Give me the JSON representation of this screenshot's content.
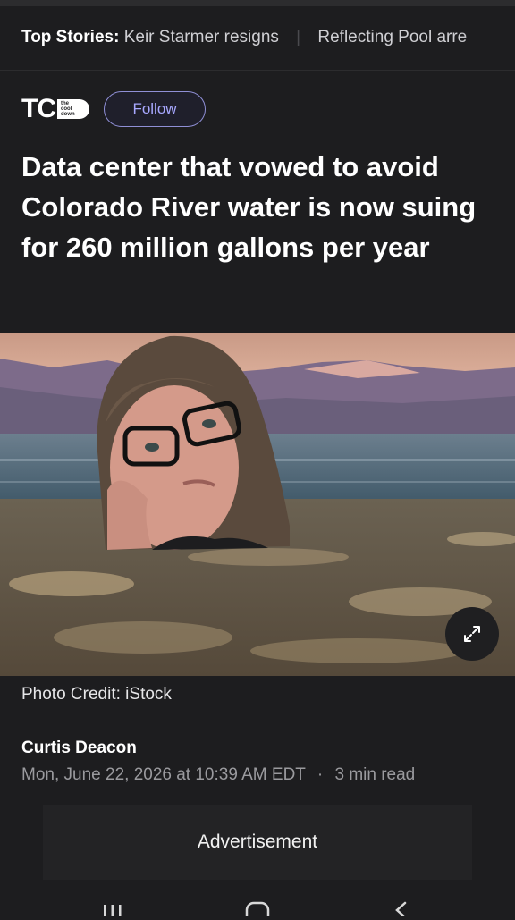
{
  "top_stories": {
    "label": "Top Stories:",
    "items": [
      "Keir Starmer resigns",
      "Reflecting Pool arre"
    ]
  },
  "publisher": {
    "logo_text": "TC",
    "logo_badge": [
      "the",
      "cool",
      "down"
    ],
    "follow_label": "Follow"
  },
  "article": {
    "headline": "Data center that vowed to avoid Colorado River water is now suing for 260 million gallons per year",
    "photo_credit": "Photo Credit: iStock",
    "author": "Curtis Deacon",
    "date": "Mon, June 22, 2026 at 10:39 AM EDT",
    "separator": "·",
    "read_time": "3 min read"
  },
  "advertisement": {
    "label": "Advertisement"
  },
  "icons": {
    "expand": "expand-diagonal-icon",
    "nav": [
      "recent-apps-icon",
      "home-icon",
      "back-icon"
    ]
  },
  "colors": {
    "background": "#1d1d1f",
    "follow_accent": "#a8a8ff",
    "meta_text": "#9a9a9e"
  }
}
